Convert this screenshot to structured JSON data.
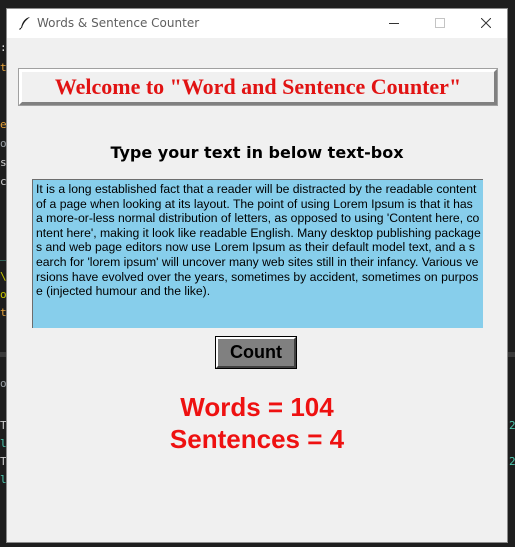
{
  "window": {
    "title": "Words & Sentence Counter"
  },
  "header": {
    "title": "Welcome to \"Word and Sentence Counter\""
  },
  "instruction": "Type your text in below text-box",
  "text_box": {
    "value": "It is a long established fact that a reader will be distracted by the readable content of a page when looking at its layout. The point of using Lorem Ipsum is that it has a more-or-less normal distribution of letters, as opposed to using 'Content here, content here', making it look like readable English. Many desktop publishing packages and web page editors now use Lorem Ipsum as their default model text, and a search for 'lorem ipsum' will uncover many web sites still in their infancy. Various versions have evolved over the years, sometimes by accident, sometimes on purpose (injected humour and the like).",
    "background": "#87ceeb"
  },
  "count_button": {
    "label": "Count"
  },
  "results": {
    "words": "Words = 104",
    "sentences": "Sentences = 4",
    "color": "#ee1111"
  },
  "icons": [
    "feather-icon",
    "minimize-icon",
    "maximize-icon",
    "close-icon"
  ]
}
